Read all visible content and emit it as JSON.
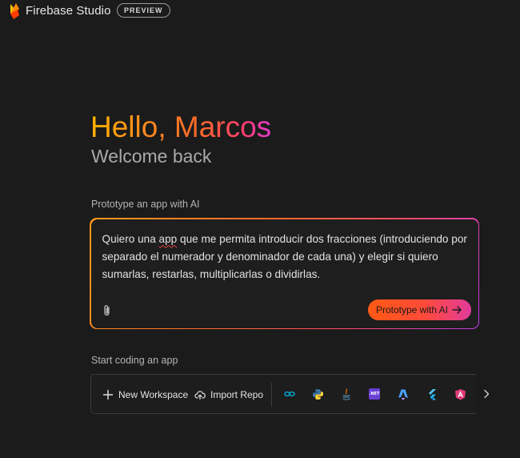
{
  "header": {
    "brand": "Firebase Studio",
    "badge": "PREVIEW"
  },
  "greeting": {
    "hello": "Hello, Marcos",
    "welcome": "Welcome back"
  },
  "prototype": {
    "label": "Prototype an app with AI",
    "prompt_before": "Quiero una ",
    "prompt_misspelled": "app",
    "prompt_after": " que me permita introducir dos fracciones (introduciendo por separado el numerador y denominador de cada una) y elegir si quiero sumarlas, restarlas, multiplicarlas o dividirlas.",
    "button_label": "Prototype with AI"
  },
  "coding": {
    "label": "Start coding an app",
    "new_workspace": "New Workspace",
    "import_repo": "Import Repo",
    "net_label": ".NET"
  },
  "colors": {
    "background": "#1b1b1b",
    "accent_orange": "#ff6a2a",
    "accent_pink": "#e23bd0"
  },
  "icons": [
    "firebase-logo-icon",
    "paperclip-icon",
    "arrow-right-icon",
    "plus-icon",
    "cloud-upload-icon",
    "go-icon",
    "python-icon",
    "java-icon",
    "dotnet-icon",
    "astro-icon",
    "flutter-icon",
    "angular-icon",
    "chevron-right-icon"
  ]
}
